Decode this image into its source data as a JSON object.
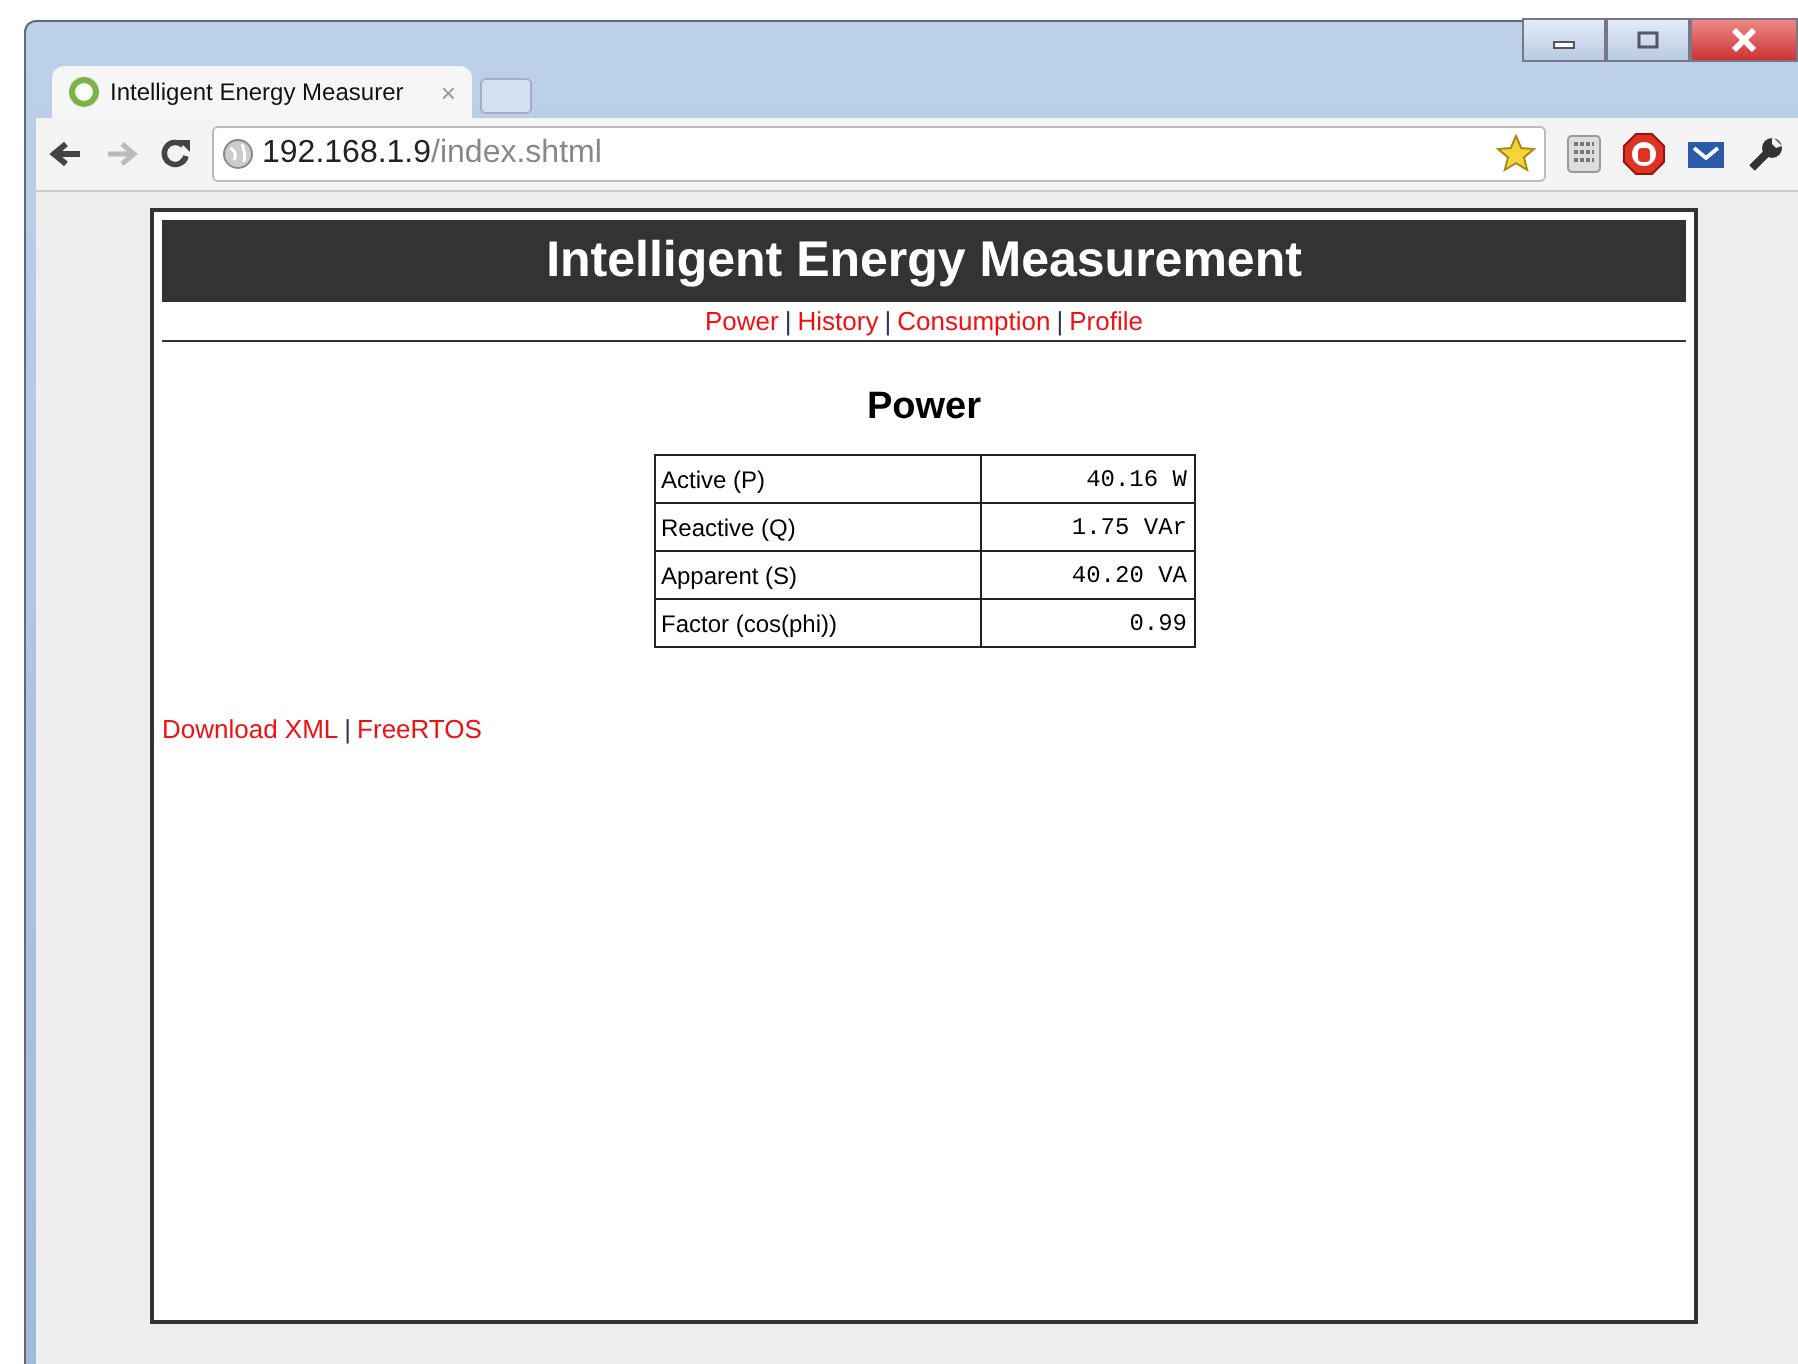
{
  "browser": {
    "tab_title": "Intelligent Energy Measurer",
    "tab_close": "×",
    "url_host": "192.168.1.9",
    "url_path": "/index.shtml"
  },
  "page": {
    "title": "Intelligent Energy Measurement",
    "nav": [
      {
        "label": "Power"
      },
      {
        "label": "History"
      },
      {
        "label": "Consumption"
      },
      {
        "label": "Profile"
      }
    ],
    "separator": "|",
    "heading": "Power",
    "rows": [
      {
        "name": "Active (P)",
        "value": "40.16 W"
      },
      {
        "name": "Reactive (Q)",
        "value": "1.75 VAr"
      },
      {
        "name": "Apparent (S)",
        "value": "40.20 VA"
      },
      {
        "name": "Factor (cos(phi))",
        "value": "0.99"
      }
    ],
    "footer_links": [
      {
        "label": "Download XML"
      },
      {
        "label": "FreeRTOS"
      }
    ]
  }
}
